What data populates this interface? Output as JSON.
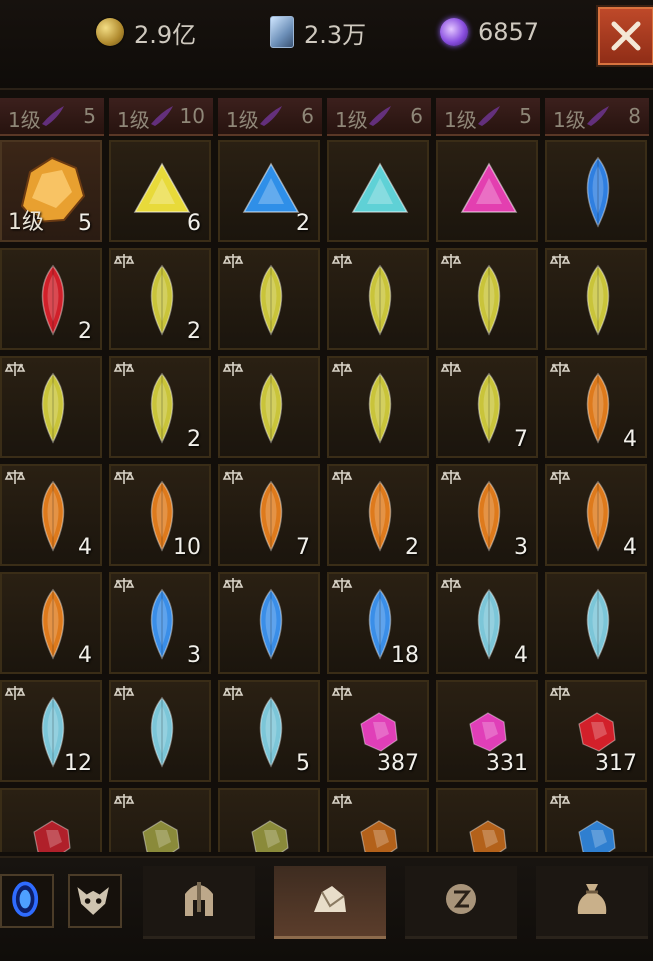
{
  "currencies": [
    {
      "icon": "gold-coin-icon",
      "value": "2.9亿"
    },
    {
      "icon": "card-icon",
      "value": "2.3万"
    },
    {
      "icon": "purple-orb-icon",
      "value": "6857"
    }
  ],
  "tiers": [
    {
      "level": "1级",
      "count": "5"
    },
    {
      "level": "1级",
      "count": "10"
    },
    {
      "level": "1级",
      "count": "6"
    },
    {
      "level": "1级",
      "count": "6"
    },
    {
      "level": "1级",
      "count": "5"
    },
    {
      "level": "1级",
      "count": "8"
    }
  ],
  "items": [
    {
      "kind": "ore",
      "color": "#e8a030",
      "level": "1级",
      "count": "5",
      "locked": false
    },
    {
      "kind": "tri",
      "color": "#e8da3a",
      "count": "6",
      "locked": false
    },
    {
      "kind": "tri",
      "color": "#2f8fe8",
      "count": "2",
      "locked": false
    },
    {
      "kind": "tri",
      "color": "#5fd1d6",
      "count": "",
      "locked": false
    },
    {
      "kind": "tri",
      "color": "#e33fb0",
      "count": "",
      "locked": false
    },
    {
      "kind": "leaf",
      "color": "#2f7fe0",
      "count": "",
      "locked": false
    },
    {
      "kind": "leaf",
      "color": "#d0202a",
      "count": "2",
      "locked": false
    },
    {
      "kind": "leaf",
      "color": "#c9c43a",
      "count": "2",
      "locked": true
    },
    {
      "kind": "leaf",
      "color": "#c9c43a",
      "count": "",
      "locked": true
    },
    {
      "kind": "leaf",
      "color": "#c9c43a",
      "count": "",
      "locked": true
    },
    {
      "kind": "leaf",
      "color": "#c9c43a",
      "count": "",
      "locked": true
    },
    {
      "kind": "leaf",
      "color": "#c9c43a",
      "count": "",
      "locked": true
    },
    {
      "kind": "leaf",
      "color": "#c9c43a",
      "count": "",
      "locked": true
    },
    {
      "kind": "leaf",
      "color": "#c9c43a",
      "count": "2",
      "locked": true
    },
    {
      "kind": "leaf",
      "color": "#c9c43a",
      "count": "",
      "locked": true
    },
    {
      "kind": "leaf",
      "color": "#c9c43a",
      "count": "",
      "locked": true
    },
    {
      "kind": "leaf",
      "color": "#c9c43a",
      "count": "7",
      "locked": true
    },
    {
      "kind": "leaf",
      "color": "#de7a1c",
      "count": "4",
      "locked": true
    },
    {
      "kind": "leaf",
      "color": "#de7a1c",
      "count": "4",
      "locked": true
    },
    {
      "kind": "leaf",
      "color": "#de7a1c",
      "count": "10",
      "locked": true
    },
    {
      "kind": "leaf",
      "color": "#de7a1c",
      "count": "7",
      "locked": true
    },
    {
      "kind": "leaf",
      "color": "#de7a1c",
      "count": "2",
      "locked": true
    },
    {
      "kind": "leaf",
      "color": "#de7a1c",
      "count": "3",
      "locked": true
    },
    {
      "kind": "leaf",
      "color": "#de7a1c",
      "count": "4",
      "locked": true
    },
    {
      "kind": "leaf",
      "color": "#de7a1c",
      "count": "4",
      "locked": false
    },
    {
      "kind": "leaf",
      "color": "#3a8ee8",
      "count": "3",
      "locked": true
    },
    {
      "kind": "leaf",
      "color": "#3a8ee8",
      "count": "",
      "locked": true
    },
    {
      "kind": "leaf",
      "color": "#3a8ee8",
      "count": "18",
      "locked": true
    },
    {
      "kind": "leaf",
      "color": "#7cc6d8",
      "count": "4",
      "locked": true
    },
    {
      "kind": "leaf",
      "color": "#7cc6d8",
      "count": "",
      "locked": false
    },
    {
      "kind": "leaf",
      "color": "#7cc6d8",
      "count": "12",
      "locked": true
    },
    {
      "kind": "leaf",
      "color": "#7cc6d8",
      "count": "",
      "locked": true
    },
    {
      "kind": "leaf",
      "color": "#7cc6d8",
      "count": "5",
      "locked": true
    },
    {
      "kind": "round",
      "color": "#e03fb8",
      "count": "387",
      "locked": true
    },
    {
      "kind": "round",
      "color": "#e03fb8",
      "count": "331",
      "locked": false
    },
    {
      "kind": "round",
      "color": "#d2202a",
      "count": "317",
      "locked": true
    },
    {
      "kind": "round",
      "color": "#b0202a",
      "count": "",
      "locked": false
    },
    {
      "kind": "round",
      "color": "#8a8a3a",
      "count": "",
      "locked": true
    },
    {
      "kind": "round",
      "color": "#8a8a3a",
      "count": "",
      "locked": false
    },
    {
      "kind": "round",
      "color": "#b3611a",
      "count": "",
      "locked": true
    },
    {
      "kind": "round",
      "color": "#b3611a",
      "count": "",
      "locked": false
    },
    {
      "kind": "round",
      "color": "#2f7fd0",
      "count": "",
      "locked": true
    }
  ],
  "bottom": {
    "buttons": [
      {
        "icon": "blue-portal-icon"
      },
      {
        "icon": "demon-mask-icon"
      }
    ],
    "tabs": [
      {
        "icon": "helmet-icon",
        "active": false
      },
      {
        "icon": "gem-pile-icon",
        "active": true
      },
      {
        "icon": "rune-icon",
        "active": false
      },
      {
        "icon": "bag-icon",
        "active": false
      }
    ]
  }
}
